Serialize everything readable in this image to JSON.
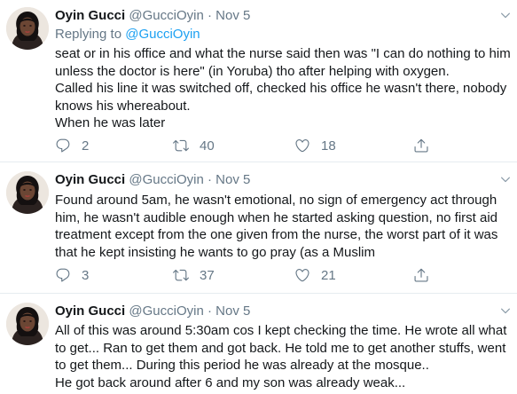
{
  "tweets": [
    {
      "name": "Oyin Gucci",
      "handle": "@GucciOyin",
      "dot": "·",
      "date": "Nov 5",
      "replying_prefix": "Replying to ",
      "replying_to": "@GucciOyin",
      "lines": [
        "seat or in his office and what the nurse said then was \"I can do nothing to him",
        "unless the doctor is here\"  (in Yoruba) tho after helping with oxygen.",
        "Called his line it was switched off, checked his office he wasn't there, nobody",
        "knows his whereabout.",
        "When he was later"
      ],
      "replies": "2",
      "retweets": "40",
      "likes": "18"
    },
    {
      "name": "Oyin Gucci",
      "handle": "@GucciOyin",
      "dot": "·",
      "date": "Nov 5",
      "lines": [
        "Found around 5am, he wasn't emotional, no sign of emergency act through",
        "him, he wasn't audible enough when he started asking question, no first aid",
        "treatment except from the one given from the nurse, the worst part of it was",
        "that he kept insisting he wants to go pray (as a Muslim"
      ],
      "replies": "3",
      "retweets": "37",
      "likes": "21"
    },
    {
      "name": "Oyin Gucci",
      "handle": "@GucciOyin",
      "dot": "·",
      "date": "Nov 5",
      "lines": [
        "All of this was around 5:30am cos I kept checking the time. He wrote all what",
        "to get... Ran to get them and got back. He told me to get another stuffs, went",
        "to get them... During this period he was already at the mosque..",
        "He got back around after 6 and my son was already weak..."
      ]
    }
  ],
  "icons": {
    "reply": "speech-bubble-icon",
    "retweet": "retweet-arrows-icon",
    "like": "heart-icon",
    "share": "share-upload-icon",
    "more": "chevron-down-icon"
  },
  "colors": {
    "accent": "#1da1f2",
    "secondary_text": "#657786",
    "divider": "#e6ecf0"
  }
}
